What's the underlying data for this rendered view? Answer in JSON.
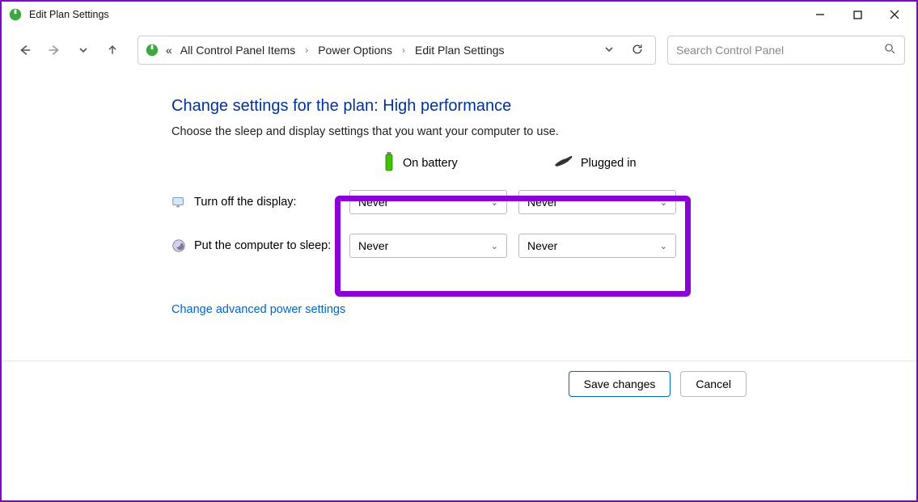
{
  "window": {
    "title": "Edit Plan Settings"
  },
  "breadcrumb": {
    "prefix": "«",
    "items": [
      "All Control Panel Items",
      "Power Options",
      "Edit Plan Settings"
    ]
  },
  "search": {
    "placeholder": "Search Control Panel"
  },
  "page": {
    "heading": "Change settings for the plan: High performance",
    "subtext": "Choose the sleep and display settings that you want your computer to use.",
    "columns": {
      "battery": "On battery",
      "plugged": "Plugged in"
    },
    "rows": {
      "display": {
        "label": "Turn off the display:",
        "battery_value": "Never",
        "plugged_value": "Never"
      },
      "sleep": {
        "label": "Put the computer to sleep:",
        "battery_value": "Never",
        "plugged_value": "Never"
      }
    },
    "advanced_link": "Change advanced power settings"
  },
  "footer": {
    "save": "Save changes",
    "cancel": "Cancel"
  }
}
